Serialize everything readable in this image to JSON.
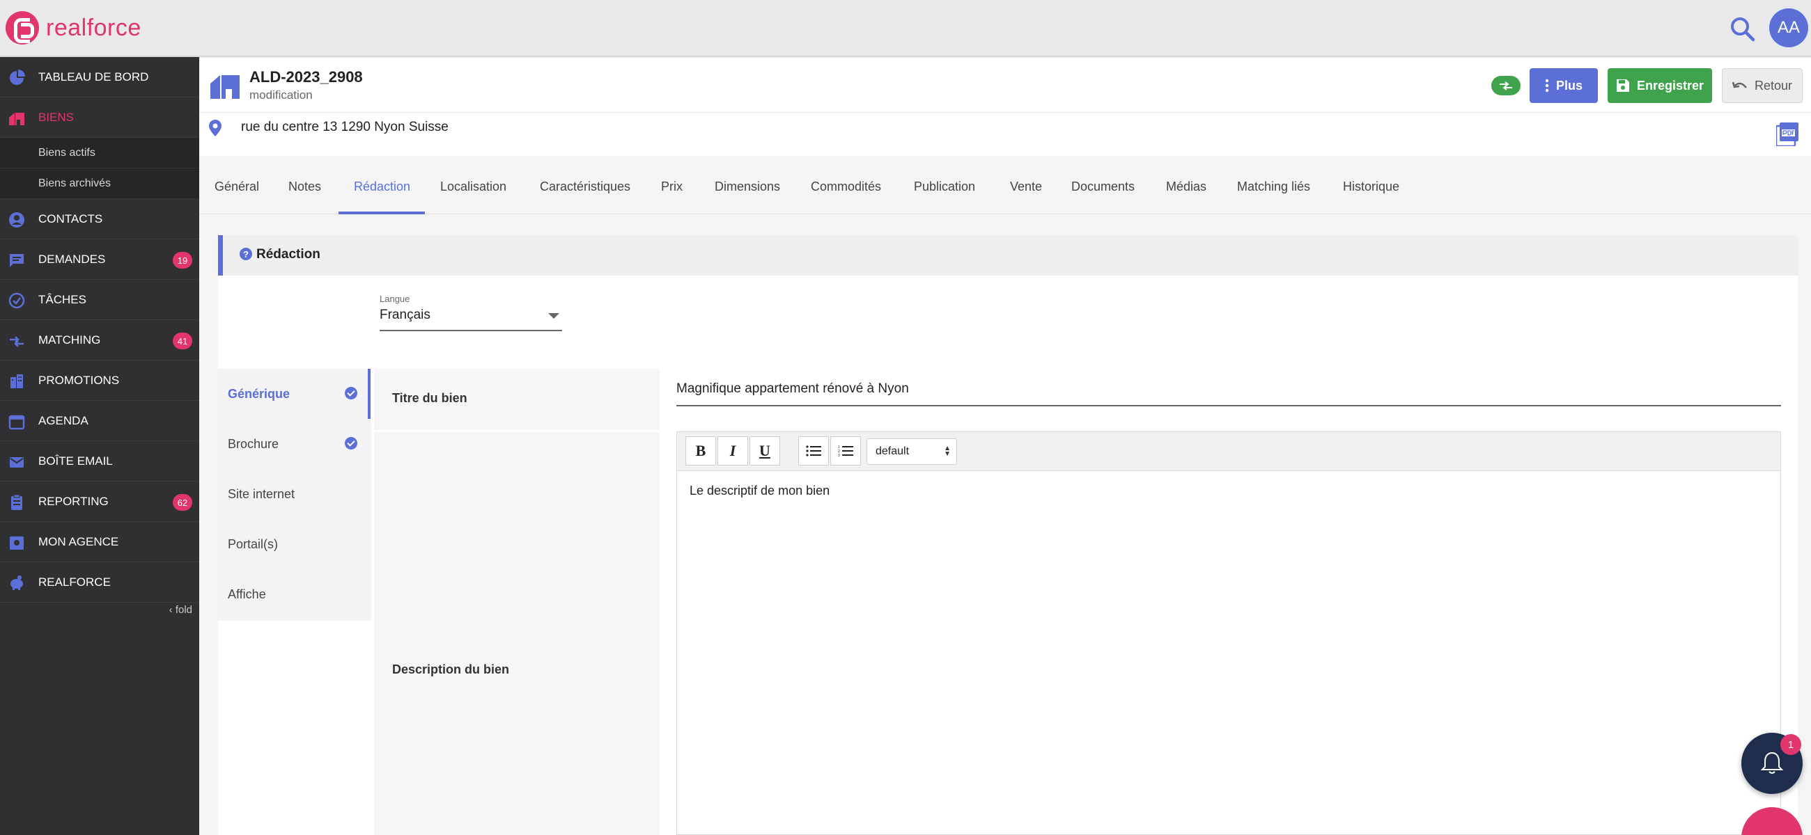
{
  "brand": {
    "name": "realforce",
    "color": "#e2356c",
    "accent": "#5b6fd6"
  },
  "topbar": {
    "avatar_initials": "AA"
  },
  "sidebar": {
    "items": [
      {
        "label": "TABLEAU DE BORD",
        "icon": "pie-chart-icon"
      },
      {
        "label": "BIENS",
        "icon": "house-icon",
        "active": true
      },
      {
        "label": "CONTACTS",
        "icon": "person-icon"
      },
      {
        "label": "DEMANDES",
        "icon": "chat-icon",
        "badge": "19"
      },
      {
        "label": "TÂCHES",
        "icon": "check-circle-icon"
      },
      {
        "label": "MATCHING",
        "icon": "swap-icon",
        "badge": "41"
      },
      {
        "label": "PROMOTIONS",
        "icon": "building-icon"
      },
      {
        "label": "AGENDA",
        "icon": "calendar-icon"
      },
      {
        "label": "BOÎTE EMAIL",
        "icon": "mail-icon"
      },
      {
        "label": "REPORTING",
        "icon": "clipboard-icon",
        "badge": "62"
      },
      {
        "label": "MON AGENCE",
        "icon": "agency-icon"
      },
      {
        "label": "REALFORCE",
        "icon": "piggy-icon"
      }
    ],
    "sub_items": [
      "Biens actifs",
      "Biens archivés"
    ],
    "fold_label": "fold"
  },
  "header": {
    "ref": "ALD-2023_2908",
    "mode": "modification",
    "plus_label": "Plus",
    "save_label": "Enregistrer",
    "back_label": "Retour",
    "address": "rue du centre 13 1290 Nyon Suisse"
  },
  "tabs": [
    "Général",
    "Notes",
    "Rédaction",
    "Localisation",
    "Caractéristiques",
    "Prix",
    "Dimensions",
    "Commodités",
    "Publication",
    "Vente",
    "Documents",
    "Médias",
    "Matching liés",
    "Historique"
  ],
  "active_tab": "Rédaction",
  "section": {
    "title": "Rédaction",
    "lang_label": "Langue",
    "lang_value": "Français",
    "subnav": [
      {
        "label": "Générique",
        "checked": true,
        "active": true
      },
      {
        "label": "Brochure",
        "checked": true
      },
      {
        "label": "Site internet",
        "checked": false
      },
      {
        "label": "Portail(s)",
        "checked": false
      },
      {
        "label": "Affiche",
        "checked": false
      }
    ],
    "title_label": "Titre du bien",
    "title_value": "Magnifique appartement rénové à Nyon",
    "desc_label": "Description du bien",
    "editor": {
      "bold": "B",
      "italic": "I",
      "underline": "U",
      "style_select": "default",
      "content": "Le descriptif de mon bien"
    }
  },
  "notifications": {
    "count": "1"
  }
}
